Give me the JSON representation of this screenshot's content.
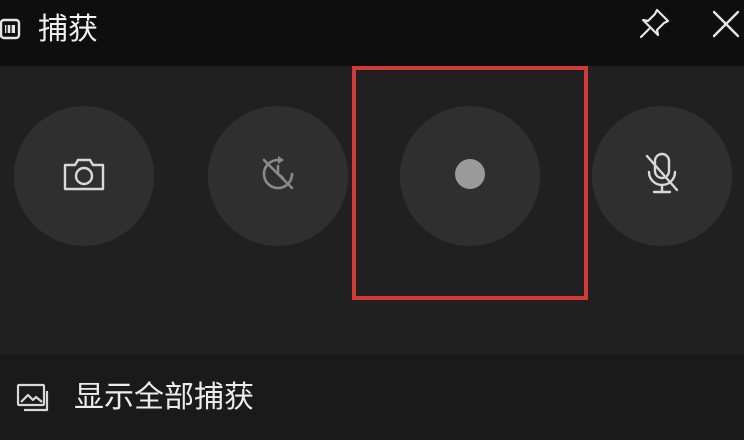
{
  "header": {
    "title": "捕获",
    "icons": {
      "app": "capture-app-icon",
      "pin": "pin-icon",
      "close": "close-icon"
    }
  },
  "controls": {
    "buttons": [
      {
        "name": "screenshot",
        "icon": "camera-icon"
      },
      {
        "name": "record-last-30s",
        "icon": "record-last-icon-disabled"
      },
      {
        "name": "start-recording",
        "icon": "record-dot-icon",
        "highlighted": true
      },
      {
        "name": "microphone",
        "icon": "mic-off-icon"
      }
    ],
    "highlight_color": "#d23a3a"
  },
  "footer": {
    "label": "显示全部捕获",
    "icon": "gallery-icon"
  },
  "colors": {
    "titlebar": "#0e0e0e",
    "panel": "#202020",
    "button": "#2f2f2f",
    "footer": "#1a1a1a",
    "icon": "#d8d8d8",
    "record_dot": "#9a9a9a"
  }
}
